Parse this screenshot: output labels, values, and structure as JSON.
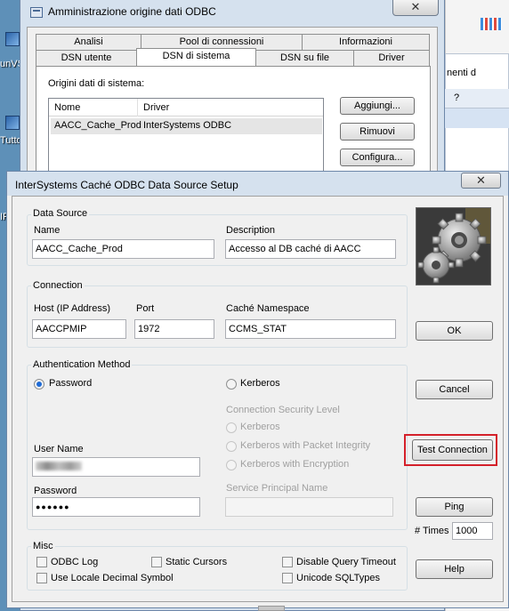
{
  "desktop": {
    "icons": [
      {
        "label": "unVS",
        "icon": "shortcut-icon"
      },
      {
        "label": "Tutto",
        "icon": "shortcut-icon"
      },
      {
        "label": "IP",
        "icon": "shortcut-icon"
      }
    ]
  },
  "background_window": {
    "partial_text": "nenti d",
    "help_glyph": "?"
  },
  "odbc_admin": {
    "title": "Amministrazione origine dati ODBC",
    "close_glyph": "✕",
    "tabs_row1": [
      "Analisi",
      "Pool di connessioni",
      "Informazioni"
    ],
    "tabs_row2": [
      "DSN utente",
      "DSN di sistema",
      "DSN su file",
      "Driver"
    ],
    "active_tab": "DSN di sistema",
    "list_label": "Origini dati di sistema:",
    "columns": [
      "Nome",
      "Driver"
    ],
    "rows": [
      {
        "name": "AACC_Cache_Prod",
        "driver": "InterSystems ODBC"
      }
    ],
    "buttons": {
      "add": "Aggiungi...",
      "remove": "Rimuovi",
      "configure": "Configura..."
    }
  },
  "dialog": {
    "title": "InterSystems Caché ODBC Data Source Setup",
    "close_glyph": "✕",
    "data_source": {
      "group_title": "Data Source",
      "name_label": "Name",
      "name_value": "AACC_Cache_Prod",
      "description_label": "Description",
      "description_value": "Accesso al DB caché di AACC"
    },
    "connection": {
      "group_title": "Connection",
      "host_label": "Host (IP Address)",
      "host_value": "AACCPMIP",
      "port_label": "Port",
      "port_value": "1972",
      "namespace_label": "Caché Namespace",
      "namespace_value": "CCMS_STAT"
    },
    "authentication": {
      "group_title": "Authentication Method",
      "password_option": "Password",
      "kerberos_option": "Kerberos",
      "selected": "Password",
      "security_level_label": "Connection Security Level",
      "security_levels": [
        "Kerberos",
        "Kerberos with Packet Integrity",
        "Kerberos with Encryption"
      ],
      "username_label": "User Name",
      "password_label": "Password",
      "password_value": "●●●●●●",
      "spn_label": "Service Principal Name",
      "spn_value": ""
    },
    "misc": {
      "group_title": "Misc",
      "options": [
        "ODBC Log",
        "Static Cursors",
        "Disable Query Timeout",
        "Use Locale Decimal Symbol",
        "Unicode SQLTypes"
      ],
      "checked": []
    },
    "buttons": {
      "ok": "OK",
      "cancel": "Cancel",
      "test_connection": "Test Connection",
      "ping": "Ping",
      "help": "Help"
    },
    "times_label": "# Times",
    "times_value": "1000",
    "highlight_color": "#d4202a"
  }
}
